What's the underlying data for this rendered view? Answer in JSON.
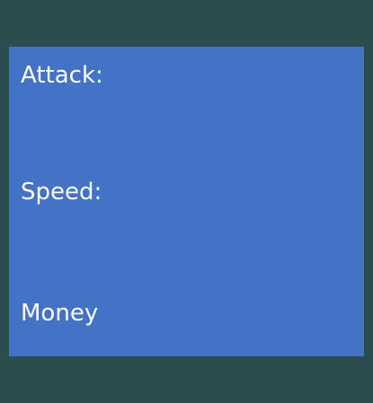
{
  "colors": {
    "background": "#2c4d4d",
    "panel": "#4472c4",
    "text": "#ffffff"
  },
  "stats_panel": {
    "attack_label": "Attack:",
    "speed_label": "Speed:",
    "money_label": "Money"
  }
}
